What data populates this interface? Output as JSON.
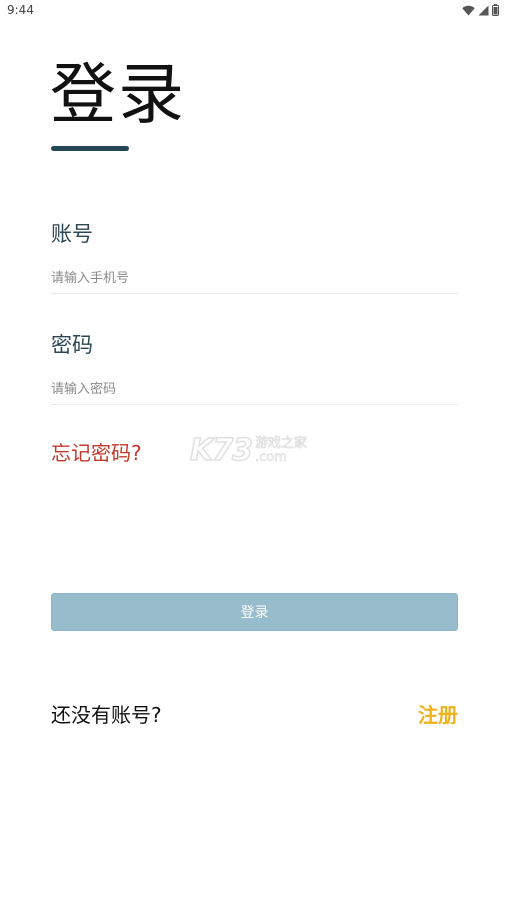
{
  "status_bar": {
    "time": "9:44",
    "icons": [
      "wifi-icon",
      "cellular-signal-icon",
      "battery-icon"
    ]
  },
  "page": {
    "title": "登录"
  },
  "account": {
    "label": "账号",
    "placeholder": "请输入手机号",
    "value": ""
  },
  "password": {
    "label": "密码",
    "placeholder": "请输入密码",
    "value": ""
  },
  "forgot_password": {
    "label": "忘记密码?"
  },
  "watermark": {
    "logo": "K73",
    "cn": "游戏之家",
    "en": ".com"
  },
  "login_button": {
    "label": "登录"
  },
  "register_prompt": {
    "text": "还没有账号?",
    "link_label": "注册"
  },
  "colors": {
    "accent_dark": "#244553",
    "label_color": "#2d4854",
    "forgot_color": "#c0392b",
    "button_bg": "#97bccb",
    "register_color": "#f0b21a"
  }
}
